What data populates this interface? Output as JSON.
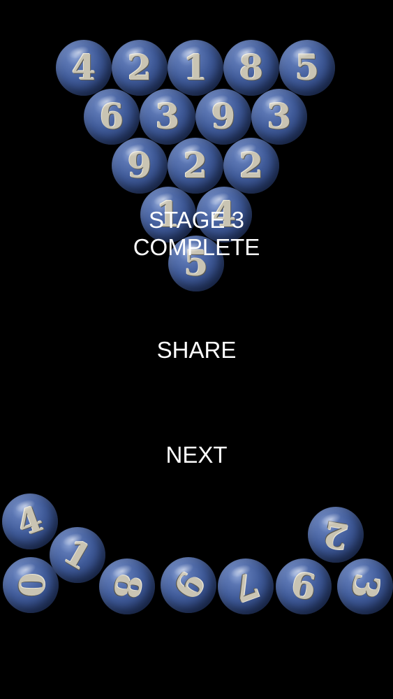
{
  "stage_label": "STAGE 3",
  "complete_label": "COMPLETE",
  "share_label": "SHARE",
  "next_label": "NEXT",
  "pyramid_rows": [
    [
      "4",
      "2",
      "1",
      "8",
      "5"
    ],
    [
      "6",
      "3",
      "9",
      "3"
    ],
    [
      "9",
      "2",
      "2"
    ],
    [
      "1",
      "4"
    ],
    [
      "5"
    ]
  ],
  "tray_balls": [
    "4",
    "1",
    "0",
    "8",
    "9",
    "7",
    "6",
    "2",
    "3"
  ],
  "colors": {
    "background": "#000000",
    "ball": "#3f5a98",
    "digit": "#c9c4b3",
    "text": "#ffffff"
  }
}
